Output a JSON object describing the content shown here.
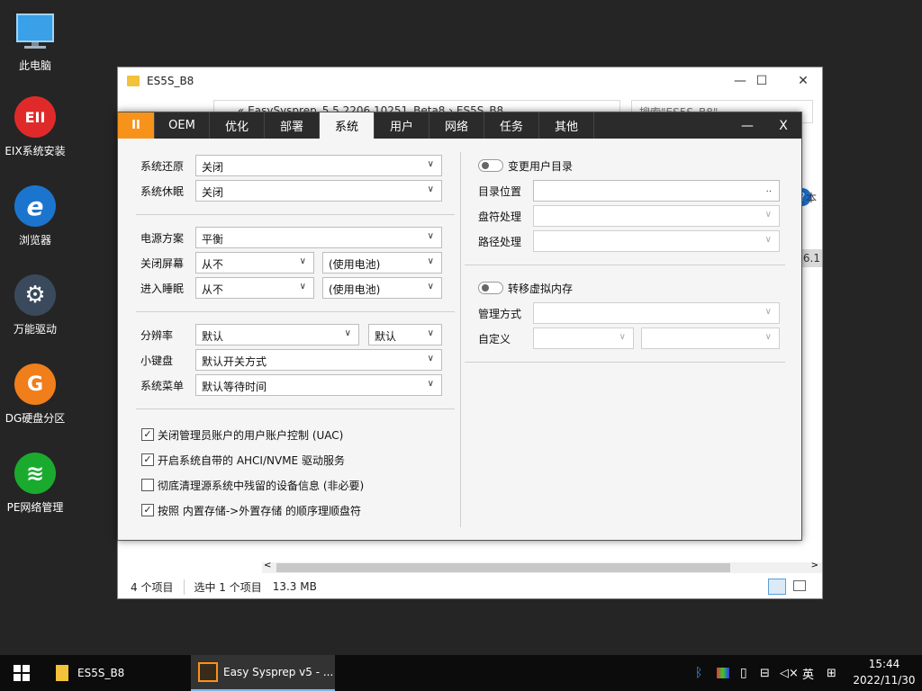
{
  "desktop": {
    "icons": [
      {
        "label": "此电脑",
        "icon": "computer-icon"
      },
      {
        "label": "EIX系统安装",
        "icon": "eix-icon",
        "glyph": "EII",
        "color": "#e02a2a"
      },
      {
        "label": "浏览器",
        "icon": "ie-browser-icon",
        "glyph": "e",
        "color": "#1b75cf"
      },
      {
        "label": "万能驱动",
        "icon": "gear-icon",
        "glyph": "⚙",
        "color": "#3a4a5c"
      },
      {
        "label": "DG硬盘分区",
        "icon": "dg-icon",
        "glyph": "G",
        "color": "#f07e1b"
      },
      {
        "label": "PE网络管理",
        "icon": "network-icon",
        "glyph": "≋",
        "color": "#1aab2e"
      }
    ]
  },
  "explorer": {
    "title": "ES5S_B8",
    "address": "« EasySysprep_5.5.2206.10251_Beta8 › ES5S_B8",
    "search_placeholder": "搜索\"ES5S_B8\"",
    "side_text_1": "本",
    "side_text_2": "06.1",
    "status": {
      "items": "4 个项目",
      "selected": "选中 1 个项目",
      "size": "13.3 MB"
    }
  },
  "sysprep": {
    "tabs": [
      "OEM",
      "优化",
      "部署",
      "系统",
      "用户",
      "网络",
      "任务",
      "其他"
    ],
    "active_tab": "系统",
    "logo": "II",
    "left": {
      "restore": {
        "label": "系统还原",
        "value": "关闭"
      },
      "hibernate": {
        "label": "系统休眠",
        "value": "关闭"
      },
      "power_plan": {
        "label": "电源方案",
        "value": "平衡"
      },
      "screen_off": {
        "label": "关闭屏幕",
        "value": "从不",
        "battery": "(使用电池)"
      },
      "sleep": {
        "label": "进入睡眠",
        "value": "从不",
        "battery": "(使用电池)"
      },
      "resolution": {
        "label": "分辨率",
        "value": "默认",
        "value2": "默认"
      },
      "keypad": {
        "label": "小键盘",
        "value": "默认开关方式"
      },
      "menu": {
        "label": "系统菜单",
        "value": "默认等待时间"
      },
      "checks": [
        {
          "label": "关闭管理员账户的用户账户控制 (UAC)",
          "checked": true
        },
        {
          "label": "开启系统自带的 AHCI/NVME 驱动服务",
          "checked": true
        },
        {
          "label": "彻底清理源系统中残留的设备信息 (非必要)",
          "checked": false
        },
        {
          "label": "按照 内置存储->外置存储 的顺序理顺盘符",
          "checked": true
        }
      ]
    },
    "right": {
      "change_user_dir": "变更用户目录",
      "dir_location": "目录位置",
      "dir_browse": "..",
      "drive_handling": "盘符处理",
      "path_handling": "路径处理",
      "move_vm": "转移虚拟内存",
      "manage_mode": "管理方式",
      "custom": "自定义"
    }
  },
  "taskbar": {
    "explorer_label": "ES5S_B8",
    "sysprep_label": "Easy Sysprep v5 - ...",
    "ime": "英",
    "time": "15:44",
    "date": "2022/11/30"
  }
}
